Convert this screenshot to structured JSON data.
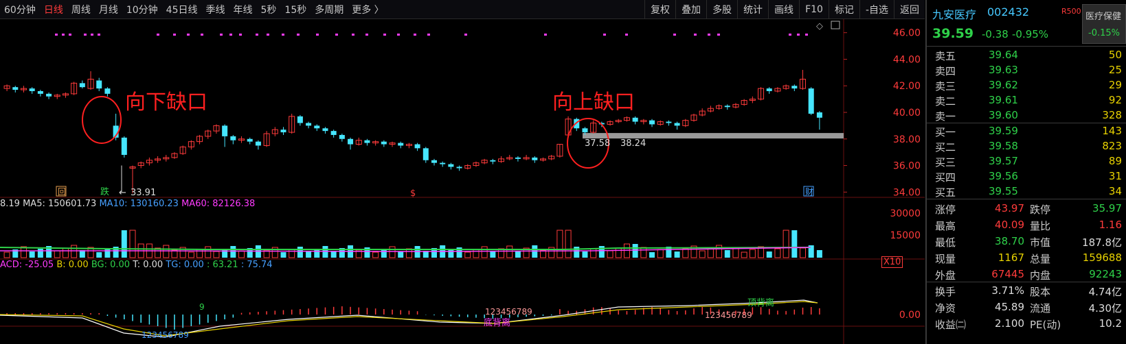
{
  "toolbar": {
    "periods": [
      "60分钟",
      "日线",
      "周线",
      "月线",
      "10分钟",
      "45日线",
      "季线",
      "年线",
      "5秒",
      "15秒",
      "多周期",
      "更多 〉"
    ],
    "active_period": "日线",
    "tools": [
      "复权",
      "叠加",
      "多股",
      "统计",
      "画线",
      "F10",
      "标记",
      "-自选",
      "返回"
    ]
  },
  "chart": {
    "price_axis": [
      "46.00",
      "44.00",
      "42.00",
      "40.00",
      "38.00",
      "36.00",
      "34.00"
    ],
    "min_label": "33.91",
    "gap_labels": [
      "37.58",
      "38.24"
    ],
    "annotations": {
      "down_gap": "向下缺口",
      "up_gap": "向上缺口"
    },
    "markers": {
      "hui": "回",
      "die": "跌",
      "s": "$",
      "cai": "财"
    }
  },
  "volume": {
    "legend": {
      "vol": "8.19",
      "ma5_label": "MA5:",
      "ma5": "150601.73",
      "ma10_label": "MA10:",
      "ma10": "130160.23",
      "ma60_label": "MA60:",
      "ma60": "82126.38"
    },
    "axis": [
      "30000",
      "15000"
    ],
    "scale": "X10"
  },
  "macd": {
    "legend": {
      "acd": "ACD: -25.05",
      "b": "B: 0.00",
      "bg": "BG: 0.00",
      "t": "T: 0.00",
      "tg": "TG: 0.00",
      "v1": ": 63.21",
      "v2": ": 75.74"
    },
    "axis": [
      "0.00"
    ],
    "labels": {
      "bottom_div": "底背离",
      "top_div": "顶背离",
      "seq1": "123456789",
      "seq2": "123456789",
      "seq3": "123456789",
      "nine": "9"
    }
  },
  "quote": {
    "name": "九安医疗",
    "code": "002432",
    "r": "R500",
    "price": "39.59",
    "change": "-0.38",
    "pct": "-0.95%",
    "sector": {
      "name": "医疗保健",
      "pct": "-0.15%"
    }
  },
  "order_book": {
    "sell": [
      {
        "label": "卖五",
        "price": "39.64",
        "vol": "50"
      },
      {
        "label": "卖四",
        "price": "39.63",
        "vol": "25"
      },
      {
        "label": "卖三",
        "price": "39.62",
        "vol": "29"
      },
      {
        "label": "卖二",
        "price": "39.61",
        "vol": "92"
      },
      {
        "label": "卖一",
        "price": "39.60",
        "vol": "328"
      }
    ],
    "buy": [
      {
        "label": "买一",
        "price": "39.59",
        "vol": "143"
      },
      {
        "label": "买二",
        "price": "39.58",
        "vol": "823"
      },
      {
        "label": "买三",
        "price": "39.57",
        "vol": "89"
      },
      {
        "label": "买四",
        "price": "39.56",
        "vol": "31"
      },
      {
        "label": "买五",
        "price": "39.55",
        "vol": "34"
      }
    ]
  },
  "stats": [
    {
      "l1": "涨停",
      "v1": "43.97",
      "c1": "red",
      "l2": "跌停",
      "v2": "35.97",
      "c2": "green"
    },
    {
      "l1": "最高",
      "v1": "40.09",
      "c1": "red",
      "l2": "量比",
      "v2": "1.16",
      "c2": "red"
    },
    {
      "l1": "最低",
      "v1": "38.70",
      "c1": "green",
      "l2": "市值",
      "v2": "187.8亿",
      "c2": "white"
    },
    {
      "l1": "现量",
      "v1": "1167",
      "c1": "yellow",
      "l2": "总量",
      "v2": "159688",
      "c2": "yellow"
    },
    {
      "l1": "外盘",
      "v1": "67445",
      "c1": "red",
      "l2": "内盘",
      "v2": "92243",
      "c2": "green"
    },
    {
      "l1": "换手",
      "v1": "3.71%",
      "c1": "white",
      "l2": "股本",
      "v2": "4.74亿",
      "c2": "white"
    },
    {
      "l1": "净资",
      "v1": "45.89",
      "c1": "white",
      "l2": "流通",
      "v2": "4.30亿",
      "c2": "white"
    },
    {
      "l1": "收益㈡",
      "v1": "2.100",
      "c1": "white",
      "l2": "PE(动)",
      "v2": "10.2",
      "c2": "white"
    }
  ],
  "chart_data": {
    "type": "candlestick",
    "y_range": [
      33.5,
      46.5
    ],
    "candles": [
      [
        41.8,
        42.0,
        41.6,
        42.1
      ],
      [
        41.9,
        41.7,
        41.5,
        42.0
      ],
      [
        41.7,
        41.8,
        41.5,
        42.0
      ],
      [
        41.8,
        41.6,
        41.4,
        41.9
      ],
      [
        41.6,
        41.4,
        41.2,
        41.7
      ],
      [
        41.4,
        41.2,
        41.0,
        41.5
      ],
      [
        41.2,
        41.3,
        41.0,
        41.4
      ],
      [
        41.3,
        41.4,
        41.1,
        41.5
      ],
      [
        41.4,
        42.2,
        41.3,
        42.3
      ],
      [
        42.2,
        41.9,
        41.8,
        42.4
      ],
      [
        41.8,
        42.5,
        41.7,
        43.1
      ],
      [
        42.4,
        41.8,
        41.6,
        42.6
      ],
      [
        41.8,
        41.4,
        41.2,
        41.9
      ],
      [
        39.0,
        38.1,
        37.9,
        39.9
      ],
      [
        38.1,
        36.8,
        36.6,
        38.2
      ],
      [
        35.8,
        35.9,
        33.9,
        36.0
      ],
      [
        36.0,
        36.2,
        35.8,
        36.3
      ],
      [
        36.2,
        36.4,
        36.0,
        36.6
      ],
      [
        36.4,
        36.5,
        36.2,
        36.7
      ],
      [
        36.5,
        36.6,
        36.3,
        36.8
      ],
      [
        36.6,
        36.9,
        36.5,
        37.0
      ],
      [
        36.9,
        37.4,
        36.8,
        37.5
      ],
      [
        37.4,
        37.8,
        37.2,
        37.9
      ],
      [
        37.8,
        38.2,
        37.6,
        38.3
      ],
      [
        38.2,
        38.6,
        38.0,
        38.7
      ],
      [
        38.6,
        39.0,
        38.4,
        39.1
      ],
      [
        39.0,
        38.2,
        37.4,
        39.1
      ],
      [
        38.2,
        37.9,
        37.6,
        38.3
      ],
      [
        37.9,
        38.0,
        37.7,
        38.2
      ],
      [
        38.0,
        37.8,
        37.6,
        38.1
      ],
      [
        37.8,
        37.5,
        37.2,
        37.9
      ],
      [
        37.5,
        38.4,
        37.4,
        38.6
      ],
      [
        38.4,
        38.7,
        38.2,
        38.9
      ],
      [
        38.7,
        38.5,
        38.3,
        38.9
      ],
      [
        38.5,
        39.7,
        38.4,
        39.9
      ],
      [
        39.7,
        39.2,
        39.0,
        39.8
      ],
      [
        39.2,
        39.0,
        38.8,
        39.3
      ],
      [
        39.0,
        38.8,
        38.6,
        39.1
      ],
      [
        38.8,
        38.6,
        38.4,
        38.9
      ],
      [
        38.6,
        38.3,
        38.1,
        38.7
      ],
      [
        38.3,
        38.0,
        37.8,
        38.4
      ],
      [
        38.0,
        37.6,
        37.2,
        38.1
      ],
      [
        37.6,
        37.9,
        37.5,
        38.1
      ],
      [
        37.9,
        37.7,
        37.5,
        38.0
      ],
      [
        37.7,
        37.8,
        37.5,
        37.9
      ],
      [
        37.8,
        37.6,
        37.4,
        37.9
      ],
      [
        37.6,
        37.7,
        37.4,
        37.8
      ],
      [
        37.7,
        37.5,
        37.3,
        37.8
      ],
      [
        37.5,
        37.6,
        37.3,
        37.7
      ],
      [
        37.6,
        37.3,
        37.1,
        37.7
      ],
      [
        37.3,
        36.4,
        36.2,
        37.4
      ],
      [
        36.4,
        36.2,
        36.0,
        36.5
      ],
      [
        36.2,
        36.1,
        35.9,
        36.3
      ],
      [
        36.1,
        35.9,
        35.7,
        36.2
      ],
      [
        35.9,
        35.8,
        35.6,
        36.0
      ],
      [
        35.8,
        36.0,
        35.7,
        36.1
      ],
      [
        36.0,
        36.2,
        35.9,
        36.3
      ],
      [
        36.2,
        36.4,
        36.1,
        36.5
      ],
      [
        36.4,
        36.3,
        36.1,
        36.5
      ],
      [
        36.3,
        36.5,
        36.2,
        36.7
      ],
      [
        36.5,
        36.6,
        36.4,
        36.8
      ],
      [
        36.6,
        36.5,
        36.3,
        36.7
      ],
      [
        36.5,
        36.6,
        36.4,
        36.8
      ],
      [
        36.6,
        36.4,
        36.2,
        36.7
      ],
      [
        36.4,
        36.5,
        36.3,
        36.6
      ],
      [
        36.5,
        36.7,
        36.4,
        36.8
      ],
      [
        36.7,
        37.6,
        36.6,
        37.6
      ],
      [
        38.3,
        39.5,
        38.2,
        39.7
      ],
      [
        39.5,
        38.8,
        38.6,
        39.6
      ],
      [
        38.8,
        38.5,
        38.3,
        38.9
      ],
      [
        38.5,
        39.2,
        38.4,
        39.4
      ],
      [
        39.2,
        39.1,
        38.9,
        39.3
      ],
      [
        39.1,
        39.3,
        39.0,
        39.4
      ],
      [
        39.3,
        39.4,
        39.2,
        39.5
      ],
      [
        39.4,
        39.6,
        39.3,
        39.7
      ],
      [
        39.6,
        39.3,
        39.1,
        39.7
      ],
      [
        39.3,
        39.4,
        39.1,
        39.5
      ],
      [
        39.4,
        39.1,
        38.9,
        39.5
      ],
      [
        39.1,
        39.3,
        39.0,
        39.4
      ],
      [
        39.3,
        39.2,
        39.0,
        39.4
      ],
      [
        39.2,
        39.0,
        38.7,
        39.3
      ],
      [
        39.0,
        39.4,
        38.9,
        39.5
      ],
      [
        39.4,
        39.8,
        39.3,
        39.9
      ],
      [
        39.8,
        40.1,
        39.7,
        40.3
      ],
      [
        40.1,
        40.3,
        40.0,
        40.5
      ],
      [
        40.3,
        40.5,
        40.2,
        40.6
      ],
      [
        40.5,
        40.4,
        40.2,
        40.6
      ],
      [
        40.4,
        40.6,
        40.3,
        40.7
      ],
      [
        40.6,
        40.9,
        40.5,
        41.0
      ],
      [
        40.9,
        41.0,
        40.7,
        41.2
      ],
      [
        41.0,
        41.8,
        40.9,
        41.9
      ],
      [
        41.8,
        41.6,
        41.4,
        41.9
      ],
      [
        41.6,
        41.8,
        41.5,
        41.9
      ],
      [
        41.8,
        42.0,
        41.7,
        42.1
      ],
      [
        42.0,
        41.8,
        41.6,
        42.1
      ],
      [
        41.8,
        42.5,
        41.7,
        43.2
      ],
      [
        41.8,
        39.9,
        39.8,
        41.9
      ],
      [
        40.0,
        39.6,
        38.7,
        40.1
      ]
    ]
  }
}
